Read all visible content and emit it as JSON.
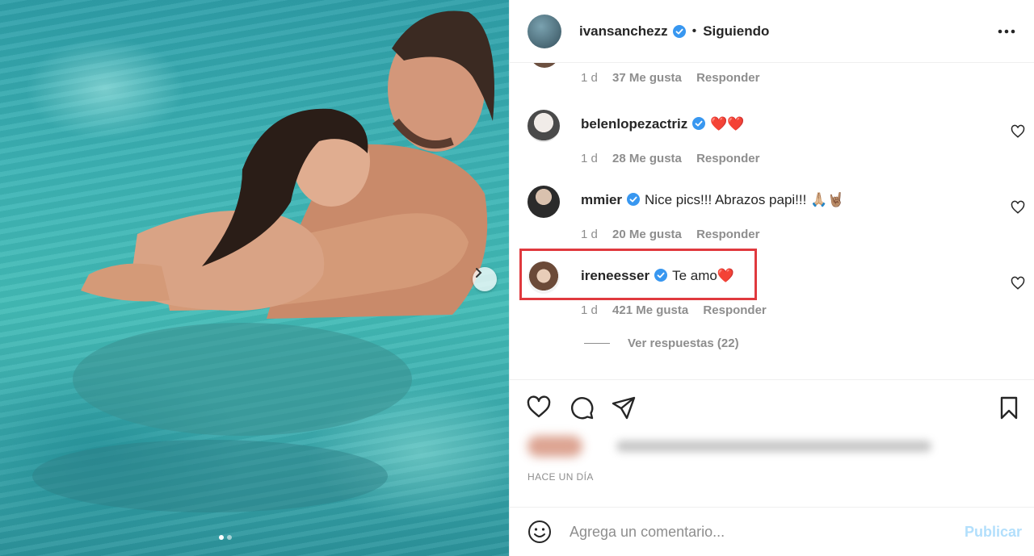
{
  "post": {
    "author": "ivansanchezz",
    "follow_status": "Siguiendo",
    "timestamp": "HACE UN DÍA",
    "carousel_dots": 2,
    "active_dot": 1
  },
  "comments_top_meta": {
    "time": "1 d",
    "likes": "37 Me gusta",
    "reply": "Responder"
  },
  "comments": [
    {
      "username": "belenlopezactriz",
      "text": "❤️❤️",
      "time": "1 d",
      "likes": "28 Me gusta",
      "reply": "Responder"
    },
    {
      "username": "mmier",
      "text": "Nice pics!!! Abrazos papi!!! 🙏🏼🤘🏽",
      "time": "1 d",
      "likes": "20 Me gusta",
      "reply": "Responder"
    },
    {
      "username": "ireneesser",
      "text": "Te amo❤️",
      "time": "1 d",
      "likes": "421 Me gusta",
      "reply": "Responder",
      "highlighted": true
    }
  ],
  "view_replies": "Ver respuestas (22)",
  "composer": {
    "placeholder": "Agrega un comentario...",
    "publish_label": "Publicar"
  },
  "icons": {
    "verified": "verified-badge-icon",
    "more": "more-options-icon",
    "like": "heart-icon",
    "comment": "comment-icon",
    "share": "paper-plane-icon",
    "save": "bookmark-icon",
    "emoji": "emoji-icon",
    "carousel": "chevron-right-icon"
  },
  "colors": {
    "verified": "#3897f0",
    "highlight_box": "#e0393e",
    "publish_disabled": "#b2dffc"
  }
}
